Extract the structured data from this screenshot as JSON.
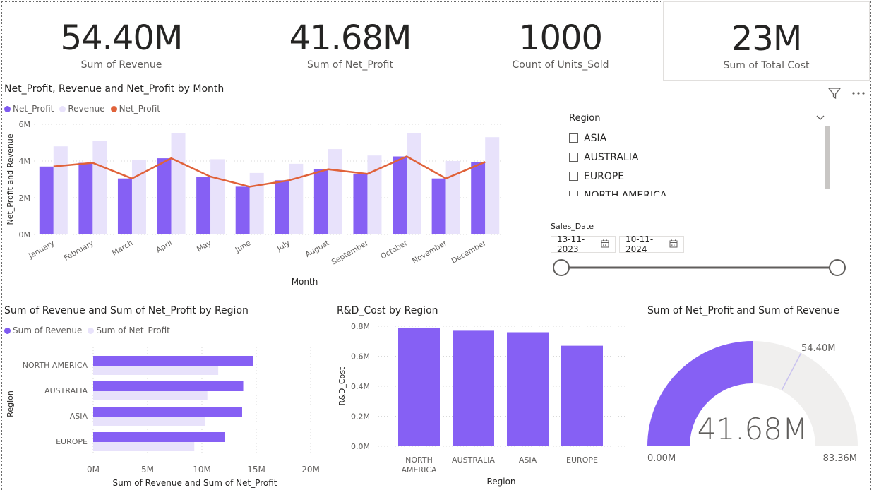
{
  "cards": [
    {
      "value": "54.40M",
      "label": "Sum of Revenue"
    },
    {
      "value": "41.68M",
      "label": "Sum of Net_Profit"
    },
    {
      "value": "1000",
      "label": "Count of Units_Sold"
    },
    {
      "value": "23M",
      "label": "Sum of Total Cost"
    }
  ],
  "colors": {
    "purple": "#7f5af0",
    "purple_main": "#8660f4",
    "lavender": "#e8e2fb",
    "orange": "#e0623a",
    "grid": "#d8d8d8",
    "gauge_bg": "#f0efee"
  },
  "monthly_chart": {
    "title": "Net_Profit, Revenue and Net_Profit by Month",
    "legend": [
      "Net_Profit",
      "Revenue",
      "Net_Profit"
    ],
    "xlabel": "Month",
    "ylabel": "Net_Profit and Revenue",
    "yticks": [
      "0M",
      "2M",
      "4M",
      "6M"
    ]
  },
  "region_slicer": {
    "title": "Region",
    "options": [
      "ASIA",
      "AUSTRALIA",
      "EUROPE",
      "NORTH AMERICA"
    ]
  },
  "date_slicer": {
    "title": "Sales_Date",
    "start": "13-11-2023",
    "end": "10-11-2024"
  },
  "region_bar_chart": {
    "title": "Sum of Revenue and Sum of Net_Profit by Region",
    "legend": [
      "Sum of Revenue",
      "Sum of Net_Profit"
    ],
    "xlabel": "Sum of Revenue and Sum of Net_Profit",
    "ylabel": "Region",
    "xticks": [
      "0M",
      "5M",
      "10M",
      "15M",
      "20M"
    ]
  },
  "rd_chart": {
    "title": "R&D_Cost by Region",
    "xlabel": "Region",
    "ylabel": "R&D_Cost",
    "yticks": [
      "0.0M",
      "0.2M",
      "0.4M",
      "0.6M",
      "0.8M"
    ]
  },
  "gauge": {
    "title": "Sum of Net_Profit and Sum of Revenue",
    "value_label": "41.68M",
    "min_label": "0.00M",
    "max_label": "83.36M",
    "target_label": "54.40M"
  },
  "chart_data": [
    {
      "type": "bar",
      "title": "Net_Profit, Revenue and Net_Profit by Month",
      "xlabel": "Month",
      "ylabel": "Net_Profit and Revenue",
      "categories": [
        "January",
        "February",
        "March",
        "April",
        "May",
        "June",
        "July",
        "August",
        "September",
        "October",
        "November",
        "December"
      ],
      "series": [
        {
          "name": "Net_Profit",
          "kind": "bar",
          "values": [
            3.7,
            3.9,
            3.05,
            4.15,
            3.15,
            2.6,
            2.95,
            3.55,
            3.3,
            4.25,
            3.05,
            3.95
          ]
        },
        {
          "name": "Revenue",
          "kind": "bar",
          "values": [
            4.8,
            5.1,
            4.05,
            5.5,
            4.1,
            3.35,
            3.85,
            4.65,
            4.3,
            5.5,
            4.0,
            5.3
          ]
        },
        {
          "name": "Net_Profit",
          "kind": "line",
          "values": [
            3.7,
            3.9,
            3.05,
            4.15,
            3.15,
            2.6,
            2.95,
            3.55,
            3.3,
            4.25,
            3.05,
            3.95
          ]
        }
      ],
      "ylim": [
        0,
        6
      ],
      "grid": true,
      "legend": "top-left"
    },
    {
      "type": "bar",
      "orientation": "horizontal",
      "title": "Sum of Revenue and Sum of Net_Profit by Region",
      "xlabel": "Sum of Revenue and Sum of Net_Profit",
      "ylabel": "Region",
      "categories": [
        "NORTH AMERICA",
        "AUSTRALIA",
        "ASIA",
        "EUROPE"
      ],
      "series": [
        {
          "name": "Sum of Revenue",
          "values": [
            14.7,
            13.8,
            13.7,
            12.1
          ]
        },
        {
          "name": "Sum of Net_Profit",
          "values": [
            11.5,
            10.5,
            10.3,
            9.3
          ]
        }
      ],
      "xlim": [
        0,
        20
      ],
      "grid": true,
      "legend": "top-left"
    },
    {
      "type": "bar",
      "title": "R&D_Cost by Region",
      "xlabel": "Region",
      "ylabel": "R&D_Cost",
      "categories": [
        "NORTH AMERICA",
        "AUSTRALIA",
        "ASIA",
        "EUROPE"
      ],
      "values": [
        0.79,
        0.77,
        0.76,
        0.67
      ],
      "ylim": [
        0,
        0.8
      ],
      "grid": true
    },
    {
      "type": "gauge",
      "title": "Sum of Net_Profit and Sum of Revenue",
      "value": 41.68,
      "min": 0,
      "max": 83.36,
      "target": 54.4,
      "units": "M"
    }
  ]
}
